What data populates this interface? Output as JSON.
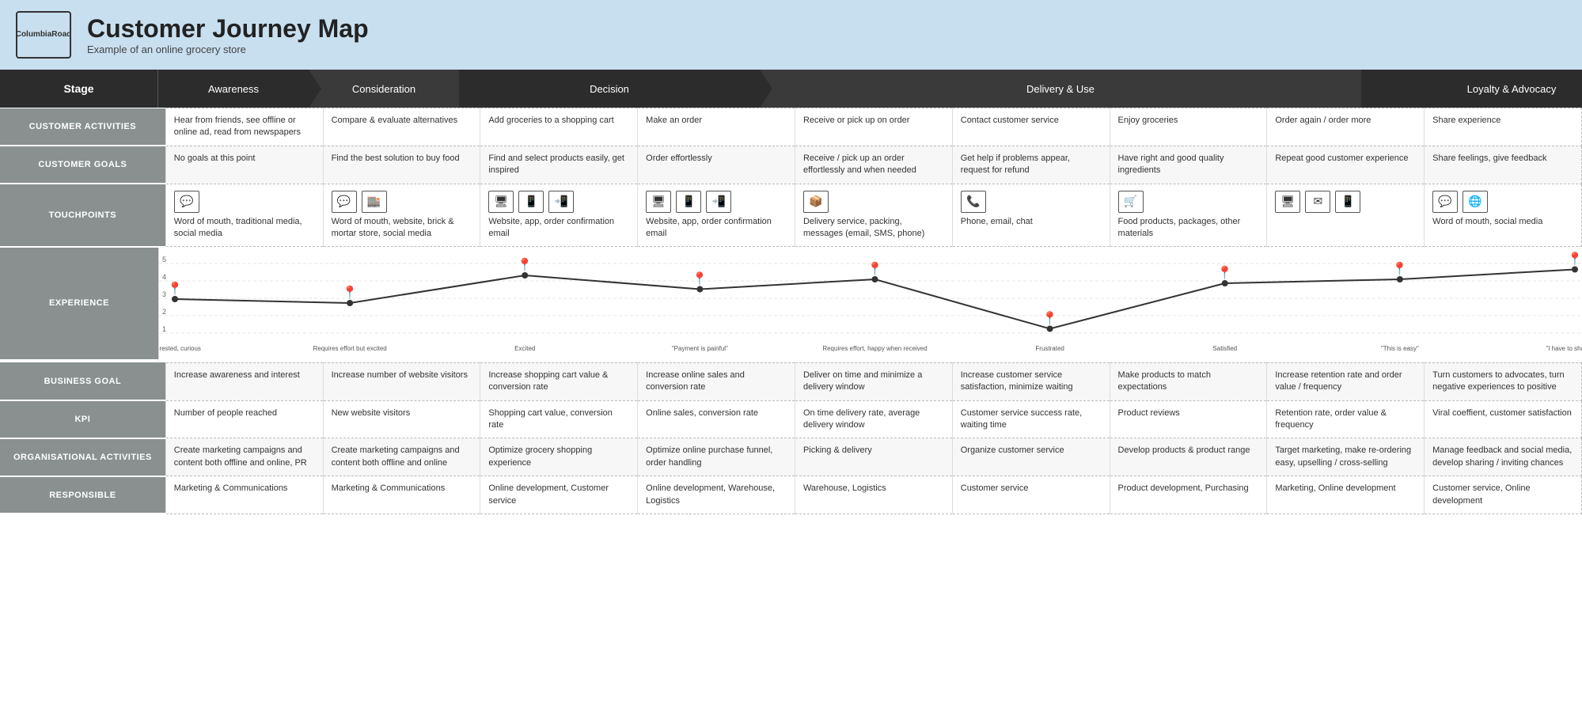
{
  "header": {
    "logo_line1": "Columbia",
    "logo_line2": "Road",
    "title": "Customer Journey Map",
    "subtitle": "Example of an online grocery store"
  },
  "stage_row": {
    "label": "Stage",
    "phases": [
      {
        "id": "awareness",
        "label": "Awareness",
        "span": 1
      },
      {
        "id": "consideration",
        "label": "Consideration",
        "span": 1
      },
      {
        "id": "decision",
        "label": "Decision",
        "span": 2
      },
      {
        "id": "delivery",
        "label": "Delivery & Use",
        "span": 4
      },
      {
        "id": "loyalty",
        "label": "Loyalty & Advocacy",
        "span": 2
      }
    ]
  },
  "columns": [
    "awareness",
    "consideration",
    "decision1",
    "decision2",
    "delivery1",
    "delivery2",
    "delivery3",
    "delivery4",
    "loyalty1",
    "loyalty2"
  ],
  "rows": {
    "customer_activities": {
      "label": "CUSTOMER ACTIVITIES",
      "cells": [
        "Hear from friends, see offline or online ad, read from newspapers",
        "Compare & evaluate alternatives",
        "Add groceries to a shopping cart",
        "Make an order",
        "Receive or pick up on order",
        "Contact customer service",
        "Enjoy groceries",
        "Order again / order more",
        "Share experience"
      ]
    },
    "customer_goals": {
      "label": "CUSTOMER GOALS",
      "cells": [
        "No goals at this point",
        "Find the best solution to buy food",
        "Find and select products easily, get inspired",
        "Order effortlessly",
        "Receive / pick up an order effortlessly and when needed",
        "Get help if problems appear, request for refund",
        "Have right and good quality ingredients",
        "Repeat good customer experience",
        "Share feelings, give feedback"
      ]
    },
    "touchpoints": {
      "label": "TOUCHPOINTS",
      "cells": [
        {
          "icons": [
            "💬"
          ],
          "text": "Word of mouth, traditional media, social media"
        },
        {
          "icons": [
            "💬"
          ],
          "text": "Word of mouth, website, brick & mortar store, social media"
        },
        {
          "icons": [
            "🖥",
            "📱",
            "🖥"
          ],
          "text": "Website, app, order confirmation email"
        },
        {
          "icons": [
            "🖥",
            "📱",
            "🖥"
          ],
          "text": "Website, app, order confirmation email"
        },
        {
          "icons": [
            "📦"
          ],
          "text": "Delivery service, packing, messages (email, SMS, phone)"
        },
        {
          "icons": [
            "📞"
          ],
          "text": "Phone, email, chat"
        },
        {
          "icons": [
            "🛒"
          ],
          "text": "Food products, packages, other materials"
        },
        {
          "icons": [
            "🖥",
            "✉",
            "📱"
          ],
          "text": ""
        },
        {
          "icons": [
            "💬",
            "🖥"
          ],
          "text": "Word of mouth, social media"
        }
      ]
    },
    "experience": {
      "label": "EXPERIENCE",
      "points": [
        3.0,
        2.8,
        4.2,
        3.5,
        4.0,
        1.5,
        3.8,
        4.0,
        4.5
      ],
      "emotions": [
        "Interested, curious",
        "Requires effort but excited",
        "Excited",
        "\"Payment is painful\"",
        "Requires effort, happy when received",
        "Frustrated",
        "Satisfied",
        "\"This is easy\"",
        "\"I have to share this\""
      ]
    },
    "business_goal": {
      "label": "BUSINESS GOAL",
      "cells": [
        "Increase awareness and interest",
        "Increase number of website visitors",
        "Increase shopping cart value & conversion rate",
        "Increase online sales and conversion rate",
        "Deliver on time and minimize a delivery window",
        "Increase customer service satisfaction, minimize waiting",
        "Make products to match expectations",
        "Increase retention rate and order value / frequency",
        "Turn customers to advocates, turn negative experiences to positive"
      ]
    },
    "kpi": {
      "label": "KPI",
      "cells": [
        "Number of people reached",
        "New website visitors",
        "Shopping cart value, conversion rate",
        "Online sales, conversion rate",
        "On time delivery rate, average delivery window",
        "Customer service success rate, waiting time",
        "Product reviews",
        "Retention rate, order value & frequency",
        "Viral coeffient, customer satisfaction"
      ]
    },
    "organisational": {
      "label": "ORGANISATIONAL ACTIVITIES",
      "cells": [
        "Create marketing campaigns and content both offline and online, PR",
        "Create marketing campaigns and content both offline and online",
        "Optimize grocery shopping experience",
        "Optimize online purchase funnel, order handling",
        "Picking & delivery",
        "Organize customer service",
        "Develop products & product range",
        "Target marketing, make re-ordering easy, upselling / cross-selling",
        "Manage feedback and social media, develop sharing / inviting chances"
      ]
    },
    "responsible": {
      "label": "RESPONSIBLE",
      "cells": [
        "Marketing & Communications",
        "Marketing & Communications",
        "Online development, Customer service",
        "Online development, Warehouse, Logistics",
        "Warehouse, Logistics",
        "Customer service",
        "Product development, Purchasing",
        "Marketing, Online development",
        "Customer service, Online development"
      ]
    }
  }
}
